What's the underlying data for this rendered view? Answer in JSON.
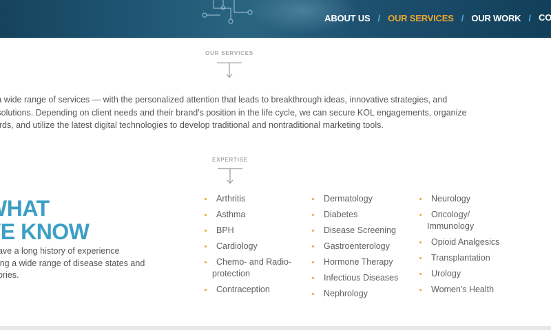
{
  "nav": {
    "items": [
      "ABOUT US",
      "OUR SERVICES",
      "OUR WORK",
      "CO"
    ],
    "active": "OUR SERVICES",
    "separator": "/"
  },
  "services": {
    "label": "OUR SERVICES",
    "intro_lines": [
      "de a wide range of services — with the personalized attention that leads to breakthrough ideas, innovative strategies, and",
      "ed solutions. Depending on client needs and their brand's position in the life cycle, we can secure KOL engagements, organize",
      "boards, and utilize the latest digital technologies to develop traditional and nontraditional marketing tools."
    ]
  },
  "expertise": {
    "label": "EXPERTISE",
    "title_line1": "WHAT",
    "title_line2": "VE KNOW",
    "text_lines": [
      "have a long history of experience",
      "ning a wide range of disease states and",
      "gories."
    ],
    "columns": [
      [
        "Arthritis",
        "Asthma",
        "BPH",
        "Cardiology",
        "Chemo- and Radio-|protection",
        "Contraception"
      ],
      [
        "Dermatology",
        "Diabetes",
        "Disease Screening",
        "Gastroenterology",
        "Hormone Therapy",
        "Infectious Diseases",
        "Nephrology"
      ],
      [
        "Neurology",
        "Oncology/|Immunology",
        "Opioid Analgesics",
        "Transplantation",
        "Urology",
        "Women's Health"
      ]
    ]
  },
  "colors": {
    "header_bg": "#1f5674",
    "nav_active": "#e8a531",
    "nav_separator": "#4fb3d9",
    "title_blue": "#3c9fc3",
    "bullet_orange": "#e8a531"
  },
  "icons": [
    "down-arrow-icon",
    "circuit-graphic-icon"
  ]
}
